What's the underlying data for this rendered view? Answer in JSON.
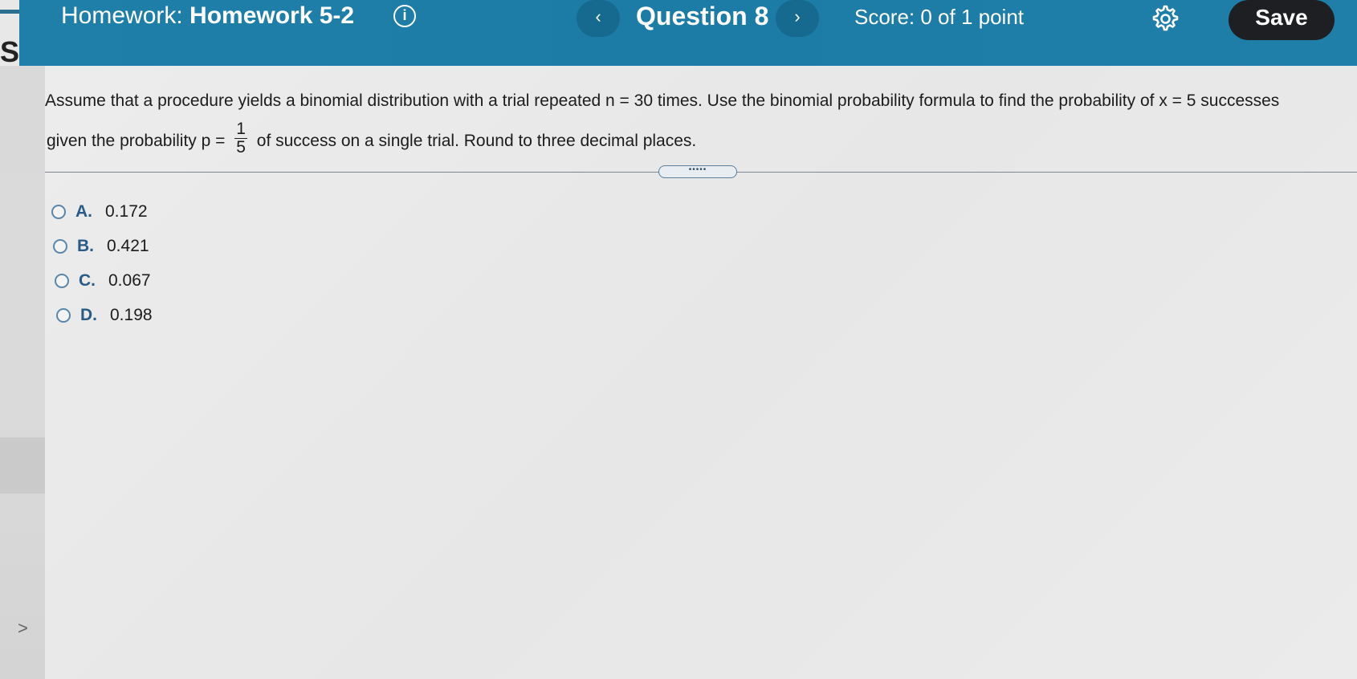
{
  "header": {
    "homework_prefix": "Homework:",
    "homework_name": "Homework 5-2",
    "info_glyph": "i",
    "prev_glyph": "‹",
    "next_glyph": "›",
    "question_label": "Question 8",
    "score_label": "Score: 0 of 1 point",
    "save_label": "Save",
    "colors": {
      "bar": "#1f7fa8",
      "save_bg": "#1d1f22"
    }
  },
  "sidebar": {
    "letter": "S",
    "expand_glyph": ">"
  },
  "question": {
    "line1": "Assume that a procedure yields a binomial distribution with a trial repeated n = 30 times. Use the binomial probability formula to find the probability of x = 5 successes",
    "line2_pre": "given the probability p =",
    "frac_num": "1",
    "frac_den": "5",
    "line2_post": "of success on a single trial. Round to three decimal places."
  },
  "divider": {
    "handle_glyph": "•••••"
  },
  "options": [
    {
      "letter": "A.",
      "value": "0.172"
    },
    {
      "letter": "B.",
      "value": "0.421"
    },
    {
      "letter": "C.",
      "value": "0.067"
    },
    {
      "letter": "D.",
      "value": "0.198"
    }
  ],
  "icons": [
    "info-icon",
    "chevron-left-icon",
    "chevron-right-icon",
    "gear-icon",
    "chevron-right-icon"
  ]
}
